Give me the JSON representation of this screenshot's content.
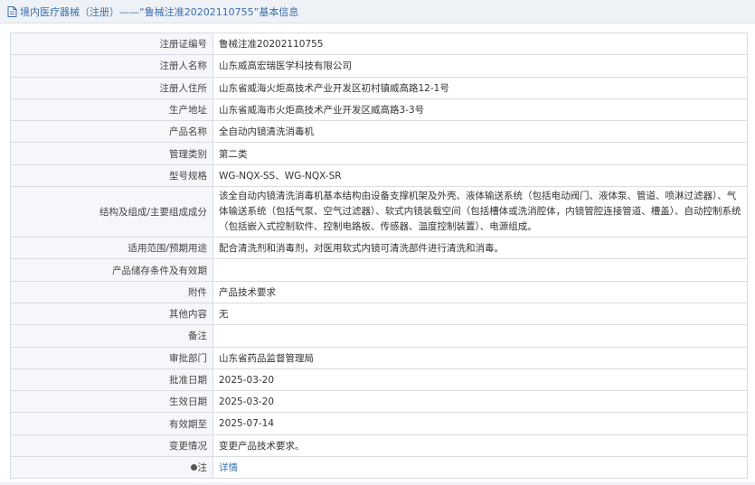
{
  "header": {
    "icon": "document-icon",
    "title": "境内医疗器械（注册）——“鲁械注准20202110755”基本信息"
  },
  "rows": [
    {
      "label": "注册证编号",
      "value": "鲁械注准20202110755"
    },
    {
      "label": "注册人名称",
      "value": "山东威高宏瑞医学科技有限公司"
    },
    {
      "label": "注册人住所",
      "value": "山东省威海火炬高技术产业开发区初村镇威高路12-1号"
    },
    {
      "label": "生产地址",
      "value": "山东省威海市火炬高技术产业开发区威高路3-3号"
    },
    {
      "label": "产品名称",
      "value": "全自动内镜清洗消毒机"
    },
    {
      "label": "管理类别",
      "value": "第二类"
    },
    {
      "label": "型号规格",
      "value": "WG-NQX-SS、WG-NQX-SR"
    },
    {
      "label": "结构及组成/主要组成成分",
      "value": "该全自动内镜清洗消毒机基本结构由设备支撑机架及外壳、液体输送系统（包括电动阀门、液体泵、管道、喷淋过滤器）、气体输送系统（包括气泵、空气过滤器）、软式内镜装载空间（包括槽体或洗消腔体，内镜管腔连接管道、槽盖）、自动控制系统（包括嵌入式控制软件、控制电路板、传感器、温度控制装置）、电源组成。"
    },
    {
      "label": "适用范围/预期用途",
      "value": "配合清洗剂和消毒剂，对医用软式内镜可清洗部件进行清洗和消毒。"
    },
    {
      "label": "产品储存条件及有效期",
      "value": ""
    },
    {
      "label": "附件",
      "value": "产品技术要求"
    },
    {
      "label": "其他内容",
      "value": "无"
    },
    {
      "label": "备注",
      "value": ""
    },
    {
      "label": "审批部门",
      "value": "山东省药品监督管理局"
    },
    {
      "label": "批准日期",
      "value": "2025-03-20"
    },
    {
      "label": "生效日期",
      "value": "2025-03-20"
    },
    {
      "label": "有效期至",
      "value": "2025-07-14"
    },
    {
      "label": "变更情况",
      "value": "变更产品技术要求。"
    }
  ],
  "note": {
    "icon": "pin-icon",
    "label": "注",
    "link": "详情"
  }
}
